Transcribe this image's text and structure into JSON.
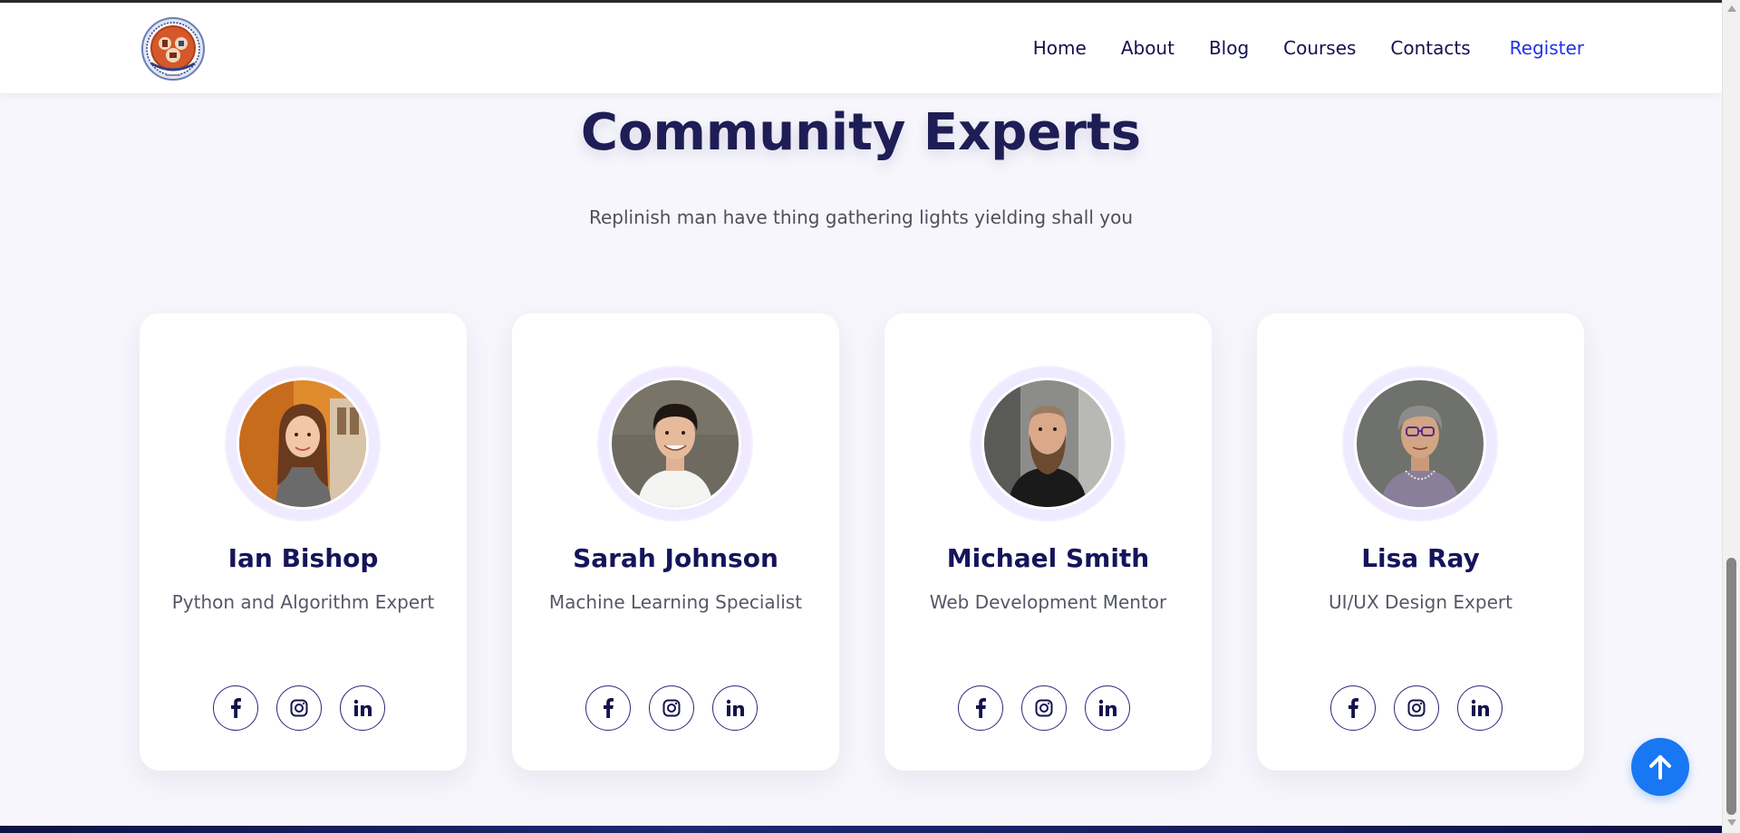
{
  "nav": {
    "logo_alt": "Institute logo",
    "links": [
      "Home",
      "About",
      "Blog",
      "Courses",
      "Contacts"
    ],
    "register": "Register"
  },
  "section": {
    "title": "Community Experts",
    "subtitle": "Replinish man have thing gathering lights yielding shall you"
  },
  "experts": [
    {
      "name": "Ian Bishop",
      "role": "Python and Algorithm Expert"
    },
    {
      "name": "Sarah Johnson",
      "role": "Machine Learning Specialist"
    },
    {
      "name": "Michael Smith",
      "role": "Web Development Mentor"
    },
    {
      "name": "Lisa Ray",
      "role": "UI/UX Design Expert"
    }
  ],
  "social_icons": [
    "facebook-icon",
    "instagram-icon",
    "linkedin-icon"
  ],
  "colors": {
    "navy": "#16145a",
    "register_blue": "#2132e6",
    "back_top_blue": "#1877f2",
    "page_bg": "#f7f6fc"
  }
}
